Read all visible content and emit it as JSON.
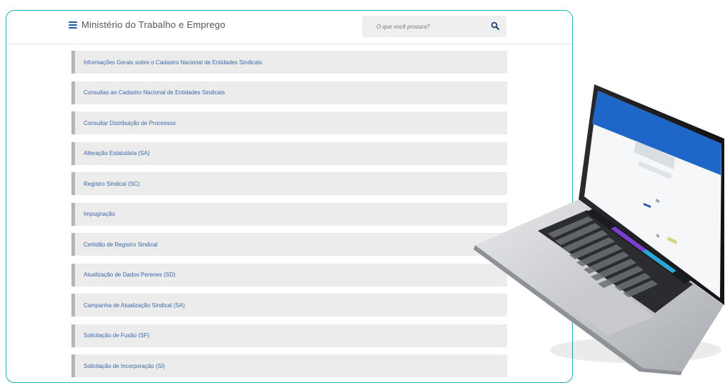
{
  "header": {
    "title": "Ministério do Trabalho e Emprego",
    "search_placeholder": "O que você procura?",
    "menu_icon": "hamburger-icon",
    "search_icon": "magnifier-icon"
  },
  "menu_items": [
    "Informações Gerais sobre o Cadastro Nacional de Entidades Sindicais",
    "Consultas ao Cadastro Nacional de Entidades Sindicais",
    "Consultar Distribuição de Processos",
    "Alteração Estatutária (SA)",
    "Registro Sindical (SC)",
    "Impugnação",
    "Certidão de Registro Sindical",
    "Atualização de Dados Perenes (SD)",
    "Campanha de Atualização Sindical (SA)",
    "Solicitação de Fusão (SF)",
    "Solicitação de Incorporação (SI)"
  ],
  "colors": {
    "frame_border": "#1bb2b5",
    "link": "#3a66a8",
    "item_bg": "#ececec",
    "item_accent": "#b5b5b5"
  }
}
